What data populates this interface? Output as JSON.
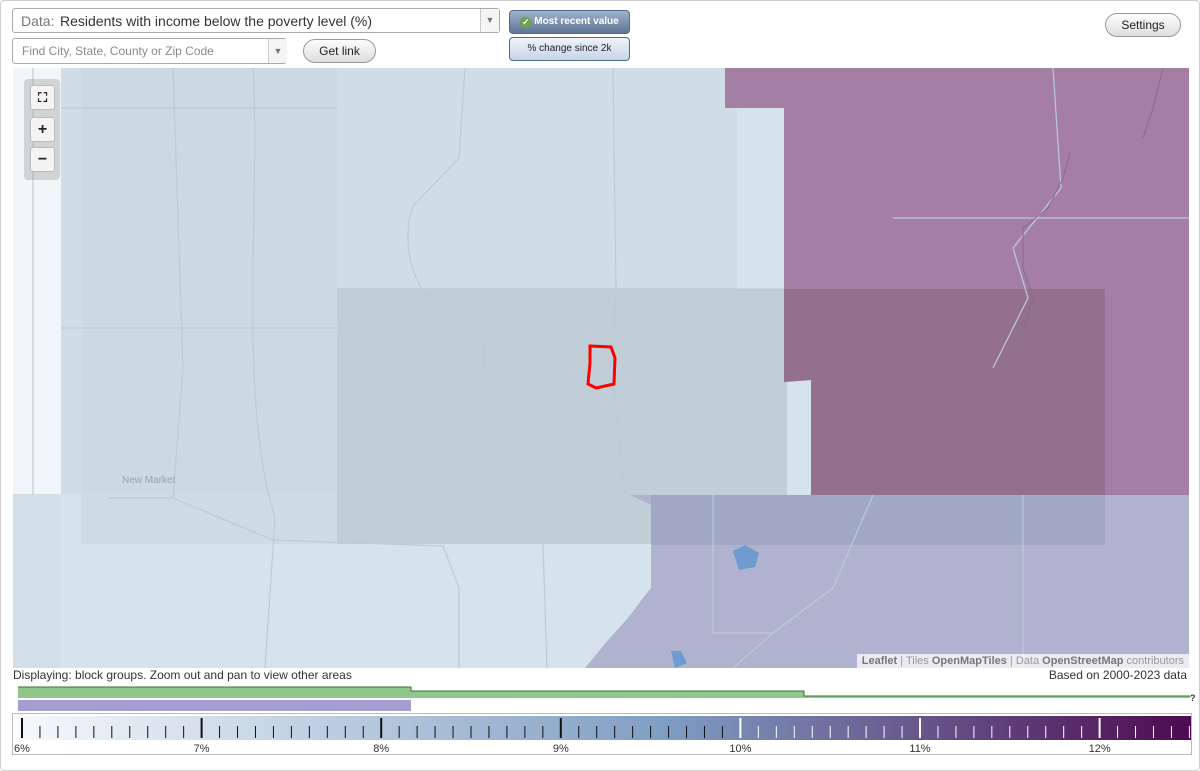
{
  "header": {
    "data_label": "Data:",
    "data_value": "Residents with income below the poverty level (%)",
    "search_placeholder": "Find City, State, County or Zip Code",
    "get_link": "Get link",
    "settings": "Settings"
  },
  "mode_buttons": {
    "most_recent": "Most recent value",
    "change_since": "% change since 2k",
    "selected": "most_recent"
  },
  "map": {
    "town_label": "New Market",
    "attribution": {
      "leaflet": "Leaflet",
      "tiles_prefix": "Tiles",
      "tiles": "OpenMapTiles",
      "data_prefix": "Data",
      "data": "OpenStreetMap",
      "suffix": "contributors"
    },
    "zoom_controls": [
      "fullscreen-icon",
      "zoom-in-icon",
      "zoom-out-icon"
    ],
    "colors": {
      "light_area": "#d3e1ea",
      "mid_area": "#c2d0da",
      "high_area": "#a57ea4",
      "high_area_overlap": "#94708f",
      "purple_area": "#b0b3d0",
      "selected_outline": "#ff0000"
    }
  },
  "status": {
    "displaying": "Displaying: block groups. Zoom out and pan to view other areas",
    "based_on": "Based on 2000-2023 data",
    "unknown_marker": "?"
  },
  "legend": {
    "ticks": [
      "6%",
      "7%",
      "8%",
      "9%",
      "10%",
      "11%",
      "12%"
    ],
    "min": 6,
    "max": 12.5,
    "color_start": "#f5f9fb",
    "color_mid": "#7f9ec3",
    "color_end": "#4d0a4f",
    "history_bars": {
      "green": "#8fc68a",
      "blue": "#a49fd0"
    }
  }
}
